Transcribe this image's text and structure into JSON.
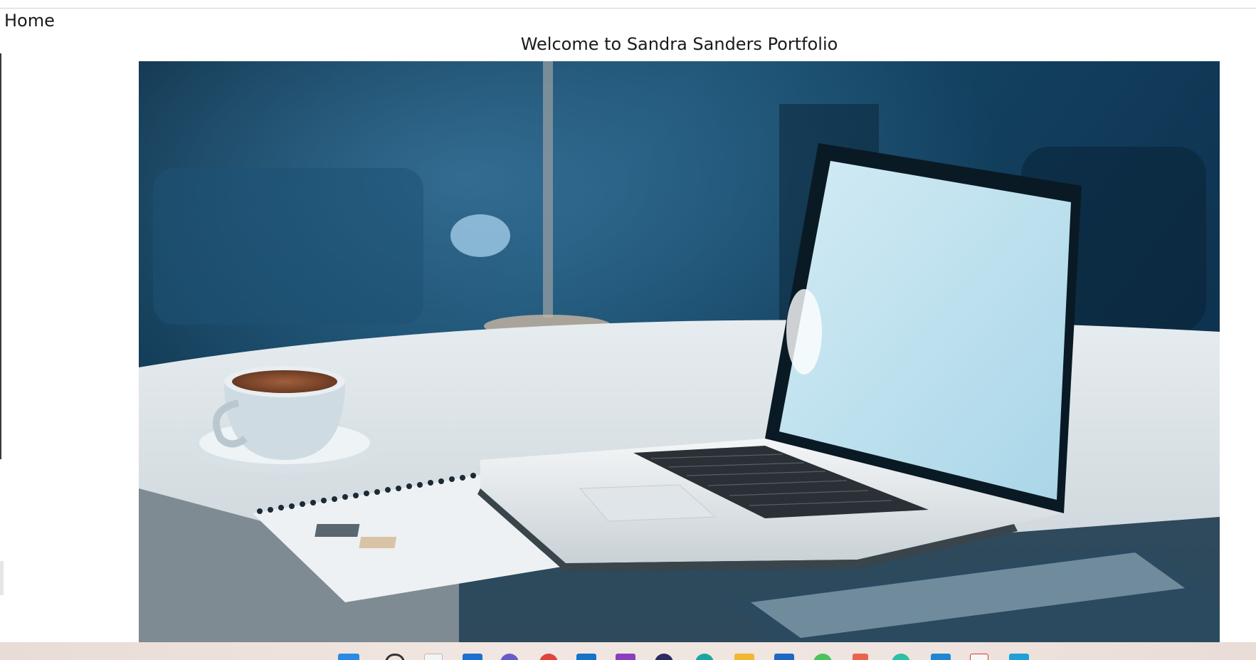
{
  "nav": {
    "home_label": "Home"
  },
  "page": {
    "title": "Welcome to Sandra Sanders Portfolio"
  },
  "hero_image": {
    "subject": "laptop-on-desk-with-coffee-cup"
  },
  "taskbar": {
    "icons": [
      "windows-start-icon",
      "search-icon",
      "file-icon",
      "widgets-icon",
      "teams-icon",
      "chrome-icon",
      "outlook-icon",
      "onenote-icon",
      "eclipse-icon",
      "edge-icon",
      "file-explorer-icon",
      "remote-desktop-icon",
      "android-icon",
      "git-icon",
      "gradle-icon",
      "vscode-icon",
      "pdf-icon",
      "store-icon"
    ]
  },
  "colors": {
    "background": "#ffffff",
    "text": "#1a1a1a",
    "hero_dark": "#0f3550",
    "laptop_screen": "#bde1ee"
  }
}
